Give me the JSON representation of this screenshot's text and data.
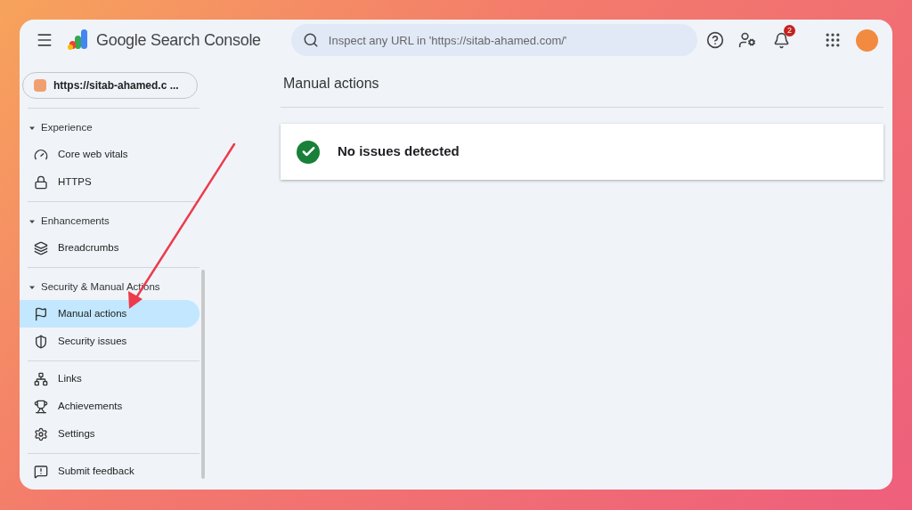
{
  "header": {
    "product": "Google Search Console",
    "search": {
      "placeholder": "Inspect any URL in 'https://sitab-ahamed.com/'"
    },
    "notifications": {
      "count": "2"
    }
  },
  "property": {
    "label": "https://sitab-ahamed.c ..."
  },
  "sidebar": {
    "sections": [
      {
        "heading": "Experience",
        "expanded": true,
        "items": [
          {
            "label": "Core web vitals",
            "kind": "gauge",
            "selected": false
          },
          {
            "label": "HTTPS",
            "kind": "lock",
            "selected": false
          }
        ]
      },
      {
        "heading": "Enhancements",
        "expanded": true,
        "items": [
          {
            "label": "Breadcrumbs",
            "kind": "layers",
            "selected": false
          }
        ]
      },
      {
        "heading": "Security & Manual Actions",
        "expanded": true,
        "items": [
          {
            "label": "Manual actions",
            "kind": "flag",
            "selected": true
          },
          {
            "label": "Security issues",
            "kind": "shield",
            "selected": false
          }
        ]
      },
      {
        "items": [
          {
            "label": "Links",
            "kind": "network",
            "selected": false
          },
          {
            "label": "Achievements",
            "kind": "trophy",
            "selected": false
          },
          {
            "label": "Settings",
            "kind": "settings",
            "selected": false
          }
        ]
      },
      {
        "items": [
          {
            "label": "Submit feedback",
            "kind": "feedback",
            "selected": false
          }
        ]
      }
    ]
  },
  "page": {
    "title": "Manual actions",
    "status": {
      "kind": "ok",
      "text": "No issues detected"
    }
  }
}
